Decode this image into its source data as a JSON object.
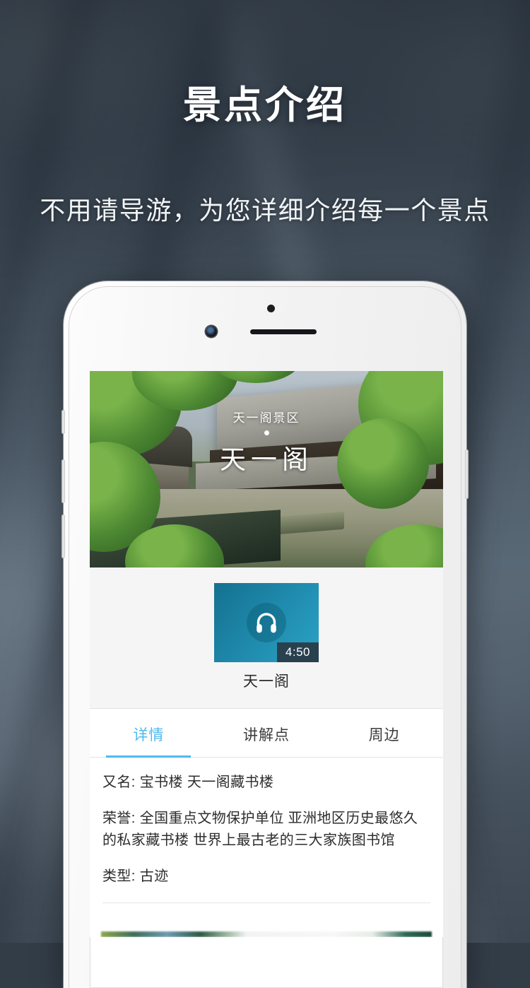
{
  "promo": {
    "title": "景点介绍",
    "subtitle": "不用请导游，为您详细介绍每一个景点"
  },
  "colors": {
    "accent": "#4fb9ef",
    "audio_card_start": "#15718f",
    "audio_card_end": "#2ba3c6",
    "duration_badge": "#29414f",
    "background": "#46525e",
    "section_bg": "#f5f5f5"
  },
  "app": {
    "hero": {
      "area_label": "天一阁景区",
      "spot_name": "天一阁"
    },
    "audio": {
      "icon": "headphones-icon",
      "duration": "4:50",
      "label": "天一阁"
    },
    "tabs": [
      {
        "label": "详情",
        "active": true
      },
      {
        "label": "讲解点",
        "active": false
      },
      {
        "label": "周边",
        "active": false
      }
    ],
    "details": [
      "又名: 宝书楼  天一阁藏书楼",
      "荣誉: 全国重点文物保护单位  亚洲地区历史最悠久的私家藏书楼  世界上最古老的三大家族图书馆",
      "类型: 古迹"
    ]
  }
}
